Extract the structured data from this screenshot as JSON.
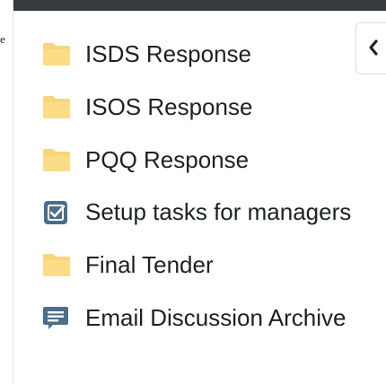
{
  "left_strip": {
    "text": "e"
  },
  "panel": {
    "collapse_button": {
      "icon": "chevron-left-icon"
    },
    "items": [
      {
        "label": "ISDS Response",
        "icon": "folder-icon"
      },
      {
        "label": "ISOS Response",
        "icon": "folder-icon"
      },
      {
        "label": "PQQ Response",
        "icon": "folder-icon"
      },
      {
        "label": "Setup tasks for managers",
        "icon": "checklist-icon"
      },
      {
        "label": "Final Tender",
        "icon": "folder-icon"
      },
      {
        "label": "Email Discussion Archive",
        "icon": "forum-icon"
      }
    ]
  },
  "colors": {
    "top_bar": "#373a3c",
    "folder": "#f9d57a",
    "checklist": "#4c6e8a",
    "forum": "#4c6e8a",
    "text": "#1d2125"
  }
}
